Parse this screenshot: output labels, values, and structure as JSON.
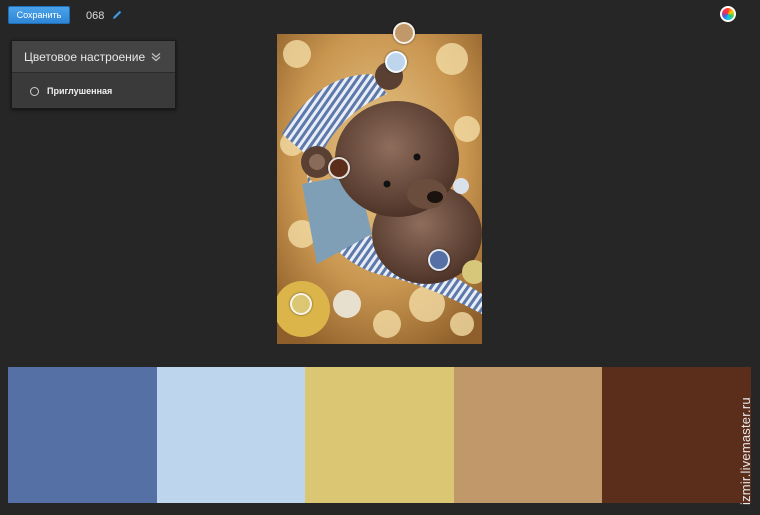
{
  "toolbar": {
    "save_label": "Сохранить",
    "title": "068"
  },
  "icons": {
    "edit": "pencil-icon",
    "color_wheel": "color-wheel-icon",
    "collapse": "chevrons-down-icon",
    "radio": "radio-icon"
  },
  "mood_panel": {
    "title": "Цветовое настроение",
    "selected_option": "Приглушенная"
  },
  "palette": {
    "colors": [
      "#5470a5",
      "#bdd6ee",
      "#dbc673",
      "#c09869",
      "#5a2e1b"
    ]
  },
  "picker_colors": [
    "#c09869",
    "#bdd6ee",
    "#5a2e1b",
    "#5470a5",
    "#dbc673"
  ],
  "watermark": "izmir.livemaster.ru"
}
